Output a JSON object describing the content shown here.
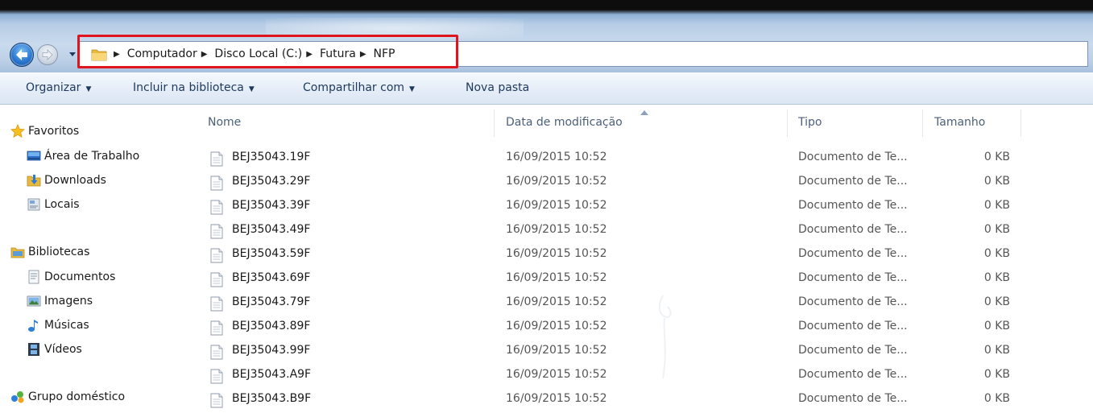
{
  "address": {
    "breadcrumb": [
      "Computador",
      "Disco Local (C:)",
      "Futura",
      "NFP"
    ]
  },
  "toolbar": {
    "organize": "Organizar",
    "include_library": "Incluir na biblioteca",
    "share_with": "Compartilhar com",
    "new_folder": "Nova pasta"
  },
  "nav": {
    "favorites": "Favoritos",
    "desktop": "Área de Trabalho",
    "downloads": "Downloads",
    "places": "Locais",
    "libraries": "Bibliotecas",
    "documents": "Documentos",
    "images": "Imagens",
    "music": "Músicas",
    "videos": "Vídeos",
    "homegroup": "Grupo doméstico"
  },
  "columns": {
    "name": "Nome",
    "modified": "Data de modificação",
    "type": "Tipo",
    "size": "Tamanho"
  },
  "files": [
    {
      "name": "BEJ35043.19F",
      "modified": "16/09/2015 10:52",
      "type": "Documento de Te...",
      "size": "0 KB"
    },
    {
      "name": "BEJ35043.29F",
      "modified": "16/09/2015 10:52",
      "type": "Documento de Te...",
      "size": "0 KB"
    },
    {
      "name": "BEJ35043.39F",
      "modified": "16/09/2015 10:52",
      "type": "Documento de Te...",
      "size": "0 KB"
    },
    {
      "name": "BEJ35043.49F",
      "modified": "16/09/2015 10:52",
      "type": "Documento de Te...",
      "size": "0 KB"
    },
    {
      "name": "BEJ35043.59F",
      "modified": "16/09/2015 10:52",
      "type": "Documento de Te...",
      "size": "0 KB"
    },
    {
      "name": "BEJ35043.69F",
      "modified": "16/09/2015 10:52",
      "type": "Documento de Te...",
      "size": "0 KB"
    },
    {
      "name": "BEJ35043.79F",
      "modified": "16/09/2015 10:52",
      "type": "Documento de Te...",
      "size": "0 KB"
    },
    {
      "name": "BEJ35043.89F",
      "modified": "16/09/2015 10:52",
      "type": "Documento de Te...",
      "size": "0 KB"
    },
    {
      "name": "BEJ35043.99F",
      "modified": "16/09/2015 10:52",
      "type": "Documento de Te...",
      "size": "0 KB"
    },
    {
      "name": "BEJ35043.A9F",
      "modified": "16/09/2015 10:52",
      "type": "Documento de Te...",
      "size": "0 KB"
    },
    {
      "name": "BEJ35043.B9F",
      "modified": "16/09/2015 10:52",
      "type": "Documento de Te...",
      "size": "0 KB"
    }
  ],
  "colors": {
    "highlight_box": "#e0141d",
    "toolbar_text": "#1e395b",
    "header_text": "#4c607a",
    "detail_text": "#555555"
  }
}
